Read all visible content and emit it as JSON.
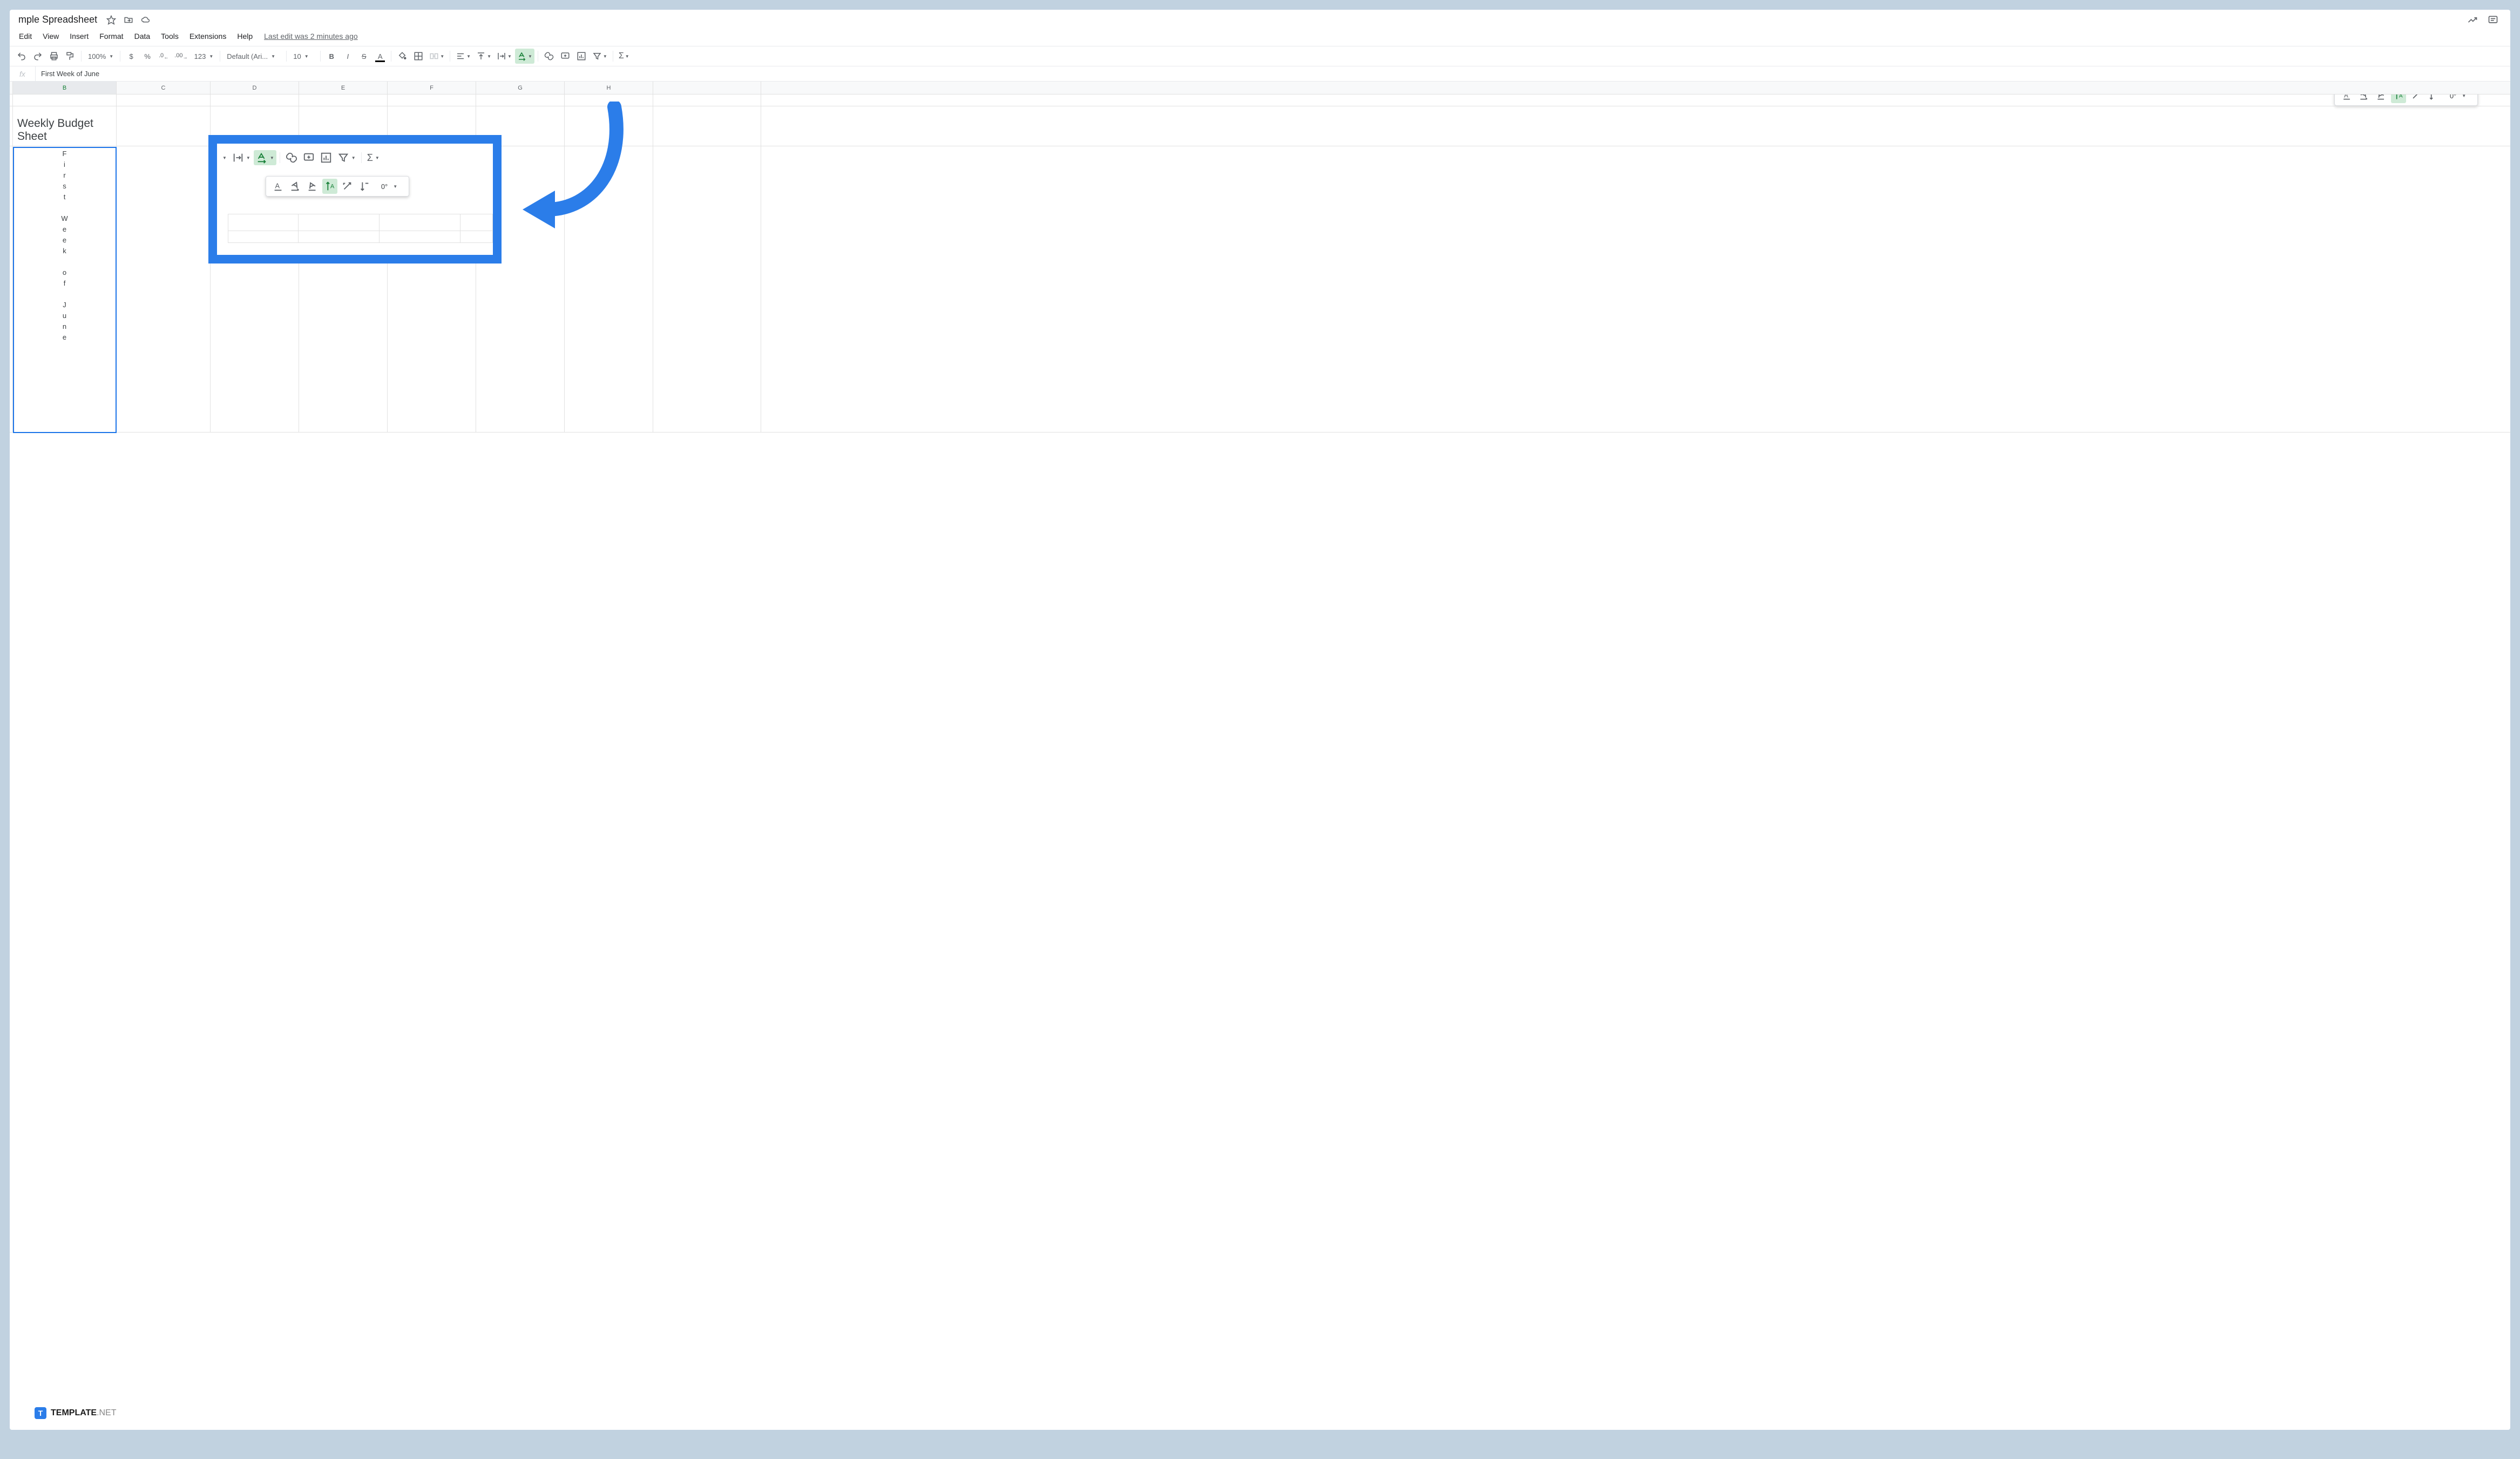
{
  "doc_title": "mple Spreadsheet",
  "menu": {
    "edit": "Edit",
    "view": "View",
    "insert": "Insert",
    "format": "Format",
    "data": "Data",
    "tools": "Tools",
    "extensions": "Extensions",
    "help": "Help",
    "last_edit": "Last edit was 2 minutes ago"
  },
  "toolbar": {
    "zoom": "100%",
    "currency": "$",
    "percent": "%",
    "dec_dec": ".0",
    "inc_dec": ".00",
    "num_format": "123",
    "font": "Default (Ari...",
    "font_size": "10",
    "bold": "B",
    "italic": "I",
    "strike": "S",
    "text_color": "A"
  },
  "formula": {
    "fx": "fx",
    "value": "First Week of June"
  },
  "columns": [
    "B",
    "C",
    "D",
    "E",
    "F",
    "G",
    "H"
  ],
  "sheet": {
    "title_cell": "Weekly Budget Sheet",
    "vertical_text": [
      "F",
      "i",
      "r",
      "s",
      "t",
      "",
      "W",
      "e",
      "e",
      "k",
      "",
      "o",
      "f",
      "",
      "J",
      "u",
      "n",
      "e"
    ]
  },
  "rotation": {
    "degrees": "0°"
  },
  "watermark": {
    "badge": "T",
    "brand": "TEMPLATE",
    "suffix": ".NET"
  }
}
